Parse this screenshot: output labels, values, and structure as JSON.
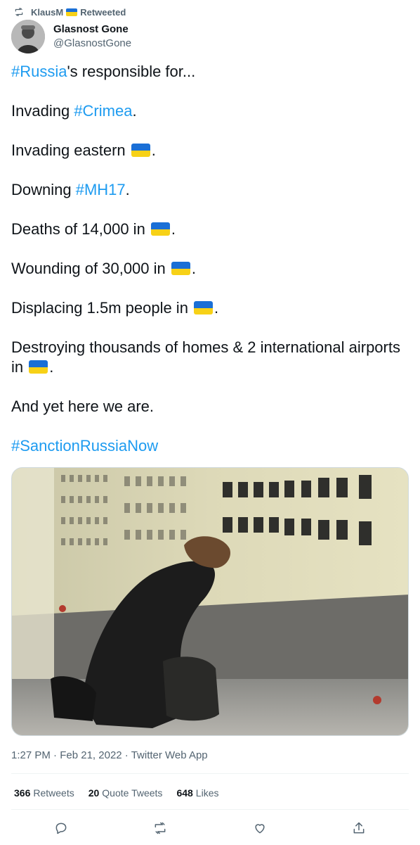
{
  "retweet": {
    "user": "KlausM",
    "label": "Retweeted"
  },
  "author": {
    "display_name": "Glasnost Gone",
    "handle": "@GlasnostGone"
  },
  "tweet": {
    "l1_tag": "#Russia",
    "l1_rest": "'s responsible for...",
    "l2_pre": "Invading ",
    "l2_tag": "#Crimea",
    "l2_post": ".",
    "l3_pre": "Invading eastern ",
    "l3_post": ".",
    "l4_pre": "Downing ",
    "l4_tag": "#MH17",
    "l4_post": ".",
    "l5_pre": "Deaths of 14,000 in ",
    "l5_post": ".",
    "l6_pre": "Wounding of 30,000 in ",
    "l6_post": ".",
    "l7_pre": "Displacing 1.5m people in ",
    "l7_post": ".",
    "l8_pre": "Destroying thousands of homes & 2 international airports in ",
    "l8_post": ".",
    "l9": "And yet here we are.",
    "l10_tag": "#SanctionRussiaNow"
  },
  "meta": {
    "time": "1:27 PM",
    "sep1": " · ",
    "date": "Feb 21, 2022",
    "sep2": " · ",
    "source": "Twitter Web App"
  },
  "stats": {
    "retweets_count": "366",
    "retweets_label": "Retweets",
    "quotes_count": "20",
    "quotes_label": "Quote Tweets",
    "likes_count": "648",
    "likes_label": "Likes"
  },
  "colors": {
    "link": "#1d9bf0",
    "secondary": "#536471",
    "flag_blue": "#1a6fd6",
    "flag_yellow": "#f7d117"
  },
  "icons": [
    "retweet-icon",
    "ukraine-flag-emoji",
    "reply-icon",
    "like-icon",
    "share-icon"
  ]
}
